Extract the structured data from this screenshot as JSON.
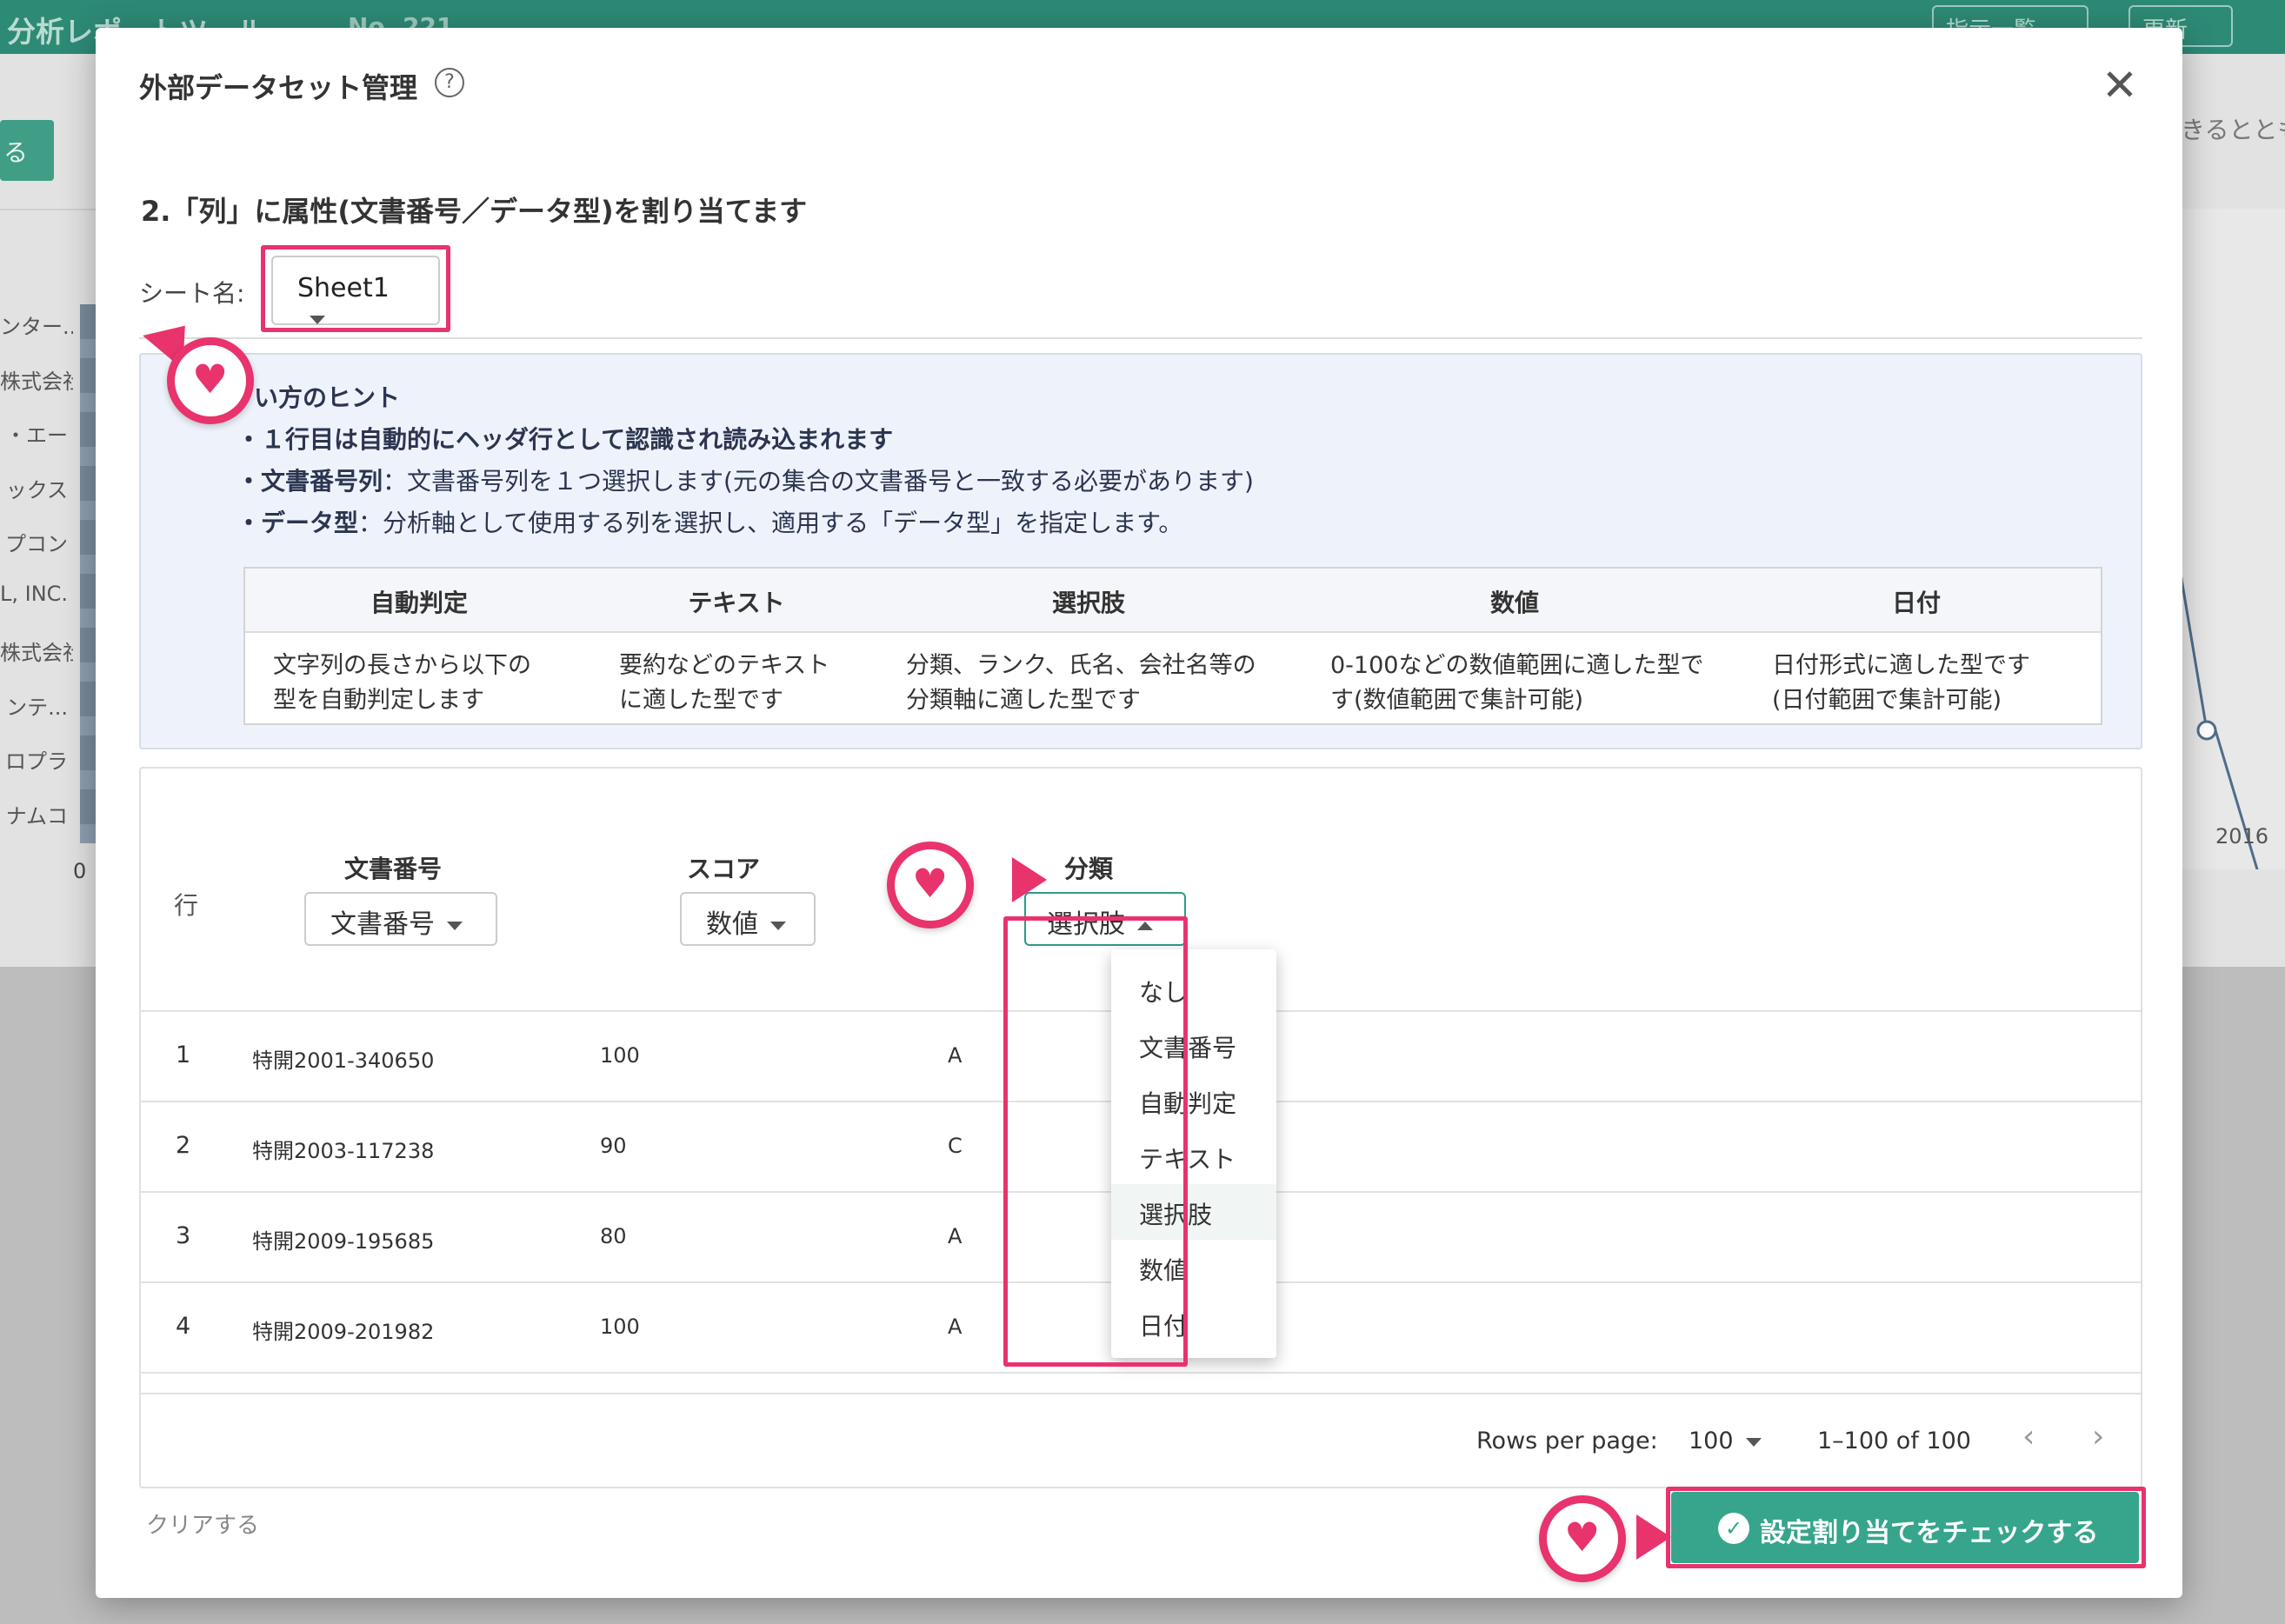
{
  "background": {
    "app_title": "分析レポートツール",
    "report_no": "No. 221",
    "header_buttons": [
      "指示一覧",
      "更新"
    ],
    "left_button": "る",
    "right_text": "きるととも",
    "bar_labels": [
      "ンター...",
      "株式会社",
      "・エー",
      "ックス",
      "プコン",
      "L, INC.",
      "株式会社",
      "ンテ...",
      "ロプラ",
      "ナムコ"
    ],
    "axis_zero": "0",
    "axis_year": "2016"
  },
  "modal": {
    "title": "外部データセット管理",
    "help_icon": "?",
    "close_icon": "✕",
    "step_title": "2.「列」に属性(文書番号／データ型)を割り当てます",
    "sheet_label": "シート名:",
    "sheet_value": "Sheet1"
  },
  "hint": {
    "title": "い方のヒント",
    "line1": "・１行目は自動的にヘッダ行として認識され読み込まれます",
    "line2_bold": "・文書番号列",
    "line2_rest": "：文書番号列を１つ選択します(元の集合の文書番号と一致する必要があります)",
    "line3_bold": "・データ型",
    "line3_rest": "：分析軸として使用する列を選択し、適用する「データ型」を指定します。",
    "types": [
      {
        "name": "自動判定",
        "desc1": "文字列の長さから以下の",
        "desc2": "型を自動判定します"
      },
      {
        "name": "テキスト",
        "desc1": "要約などのテキスト",
        "desc2": "に適した型です"
      },
      {
        "name": "選択肢",
        "desc1": "分類、ランク、氏名、会社名等の",
        "desc2": "分類軸に適した型です"
      },
      {
        "name": "数値",
        "desc1": "0-100などの数値範囲に適した型で",
        "desc2": "す(数値範囲で集計可能)"
      },
      {
        "name": "日付",
        "desc1": "日付形式に適した型です",
        "desc2": "(日付範囲で集計可能)"
      }
    ]
  },
  "columns": {
    "row_label": "行",
    "items": [
      {
        "title": "文書番号",
        "type": "文書番号"
      },
      {
        "title": "スコア",
        "type": "数値"
      },
      {
        "title": "分類",
        "type": "選択肢"
      }
    ]
  },
  "rows": [
    {
      "num": "1",
      "doc": "特開2001-340650",
      "score": "100",
      "cat": "A"
    },
    {
      "num": "2",
      "doc": "特開2003-117238",
      "score": "90",
      "cat": "C"
    },
    {
      "num": "3",
      "doc": "特開2009-195685",
      "score": "80",
      "cat": "A"
    },
    {
      "num": "4",
      "doc": "特開2009-201982",
      "score": "100",
      "cat": "A"
    }
  ],
  "dropdown": {
    "options": [
      "なし",
      "文書番号",
      "自動判定",
      "テキスト",
      "選択肢",
      "数値",
      "日付"
    ],
    "selected": "選択肢"
  },
  "pagination": {
    "rows_per_page_label": "Rows per page:",
    "rows_per_page": "100",
    "range": "1–100 of 100",
    "prev_icon": "‹",
    "next_icon": "›"
  },
  "footer": {
    "clear_label": "クリアする",
    "check_label": "設定割り当てをチェックする"
  },
  "colors": {
    "accent": "#36a58c",
    "highlight": "#e8336d",
    "header_bg": "#2d8a75",
    "hint_bg": "#eef3fb"
  }
}
